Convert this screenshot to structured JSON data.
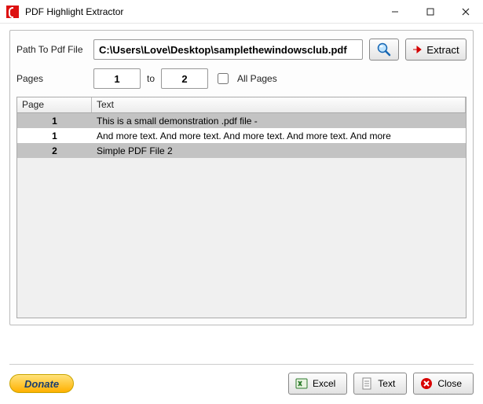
{
  "window": {
    "title": "PDF Highlight Extractor"
  },
  "form": {
    "path_label": "Path To Pdf File",
    "path_value": "C:\\Users\\Love\\Desktop\\samplethewindowsclub.pdf",
    "extract_label": "Extract",
    "pages_label": "Pages",
    "page_from": "1",
    "to_label": "to",
    "page_to": "2",
    "all_pages_label": "All Pages"
  },
  "table": {
    "headers": {
      "page": "Page",
      "text": "Text"
    },
    "rows": [
      {
        "page": "1",
        "text": "This is a small demonstration .pdf file -"
      },
      {
        "page": "1",
        "text": "And more text. And more text. And more text. And more text. And more"
      },
      {
        "page": "2",
        "text": "Simple PDF File 2"
      }
    ]
  },
  "footer": {
    "donate": "Donate",
    "excel": "Excel",
    "text": "Text",
    "close": "Close"
  }
}
